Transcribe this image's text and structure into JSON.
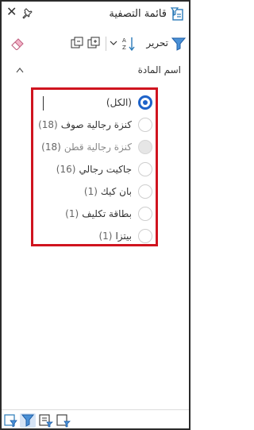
{
  "header": {
    "title": "قائمة التصفية",
    "filter_icon": "filter-list-icon",
    "pin_icon": "pin-icon",
    "close_symbol": "✕"
  },
  "toolbar": {
    "edit_label": "تحرير",
    "icons": [
      "filter-icon",
      "sort-az-icon",
      "chevron-down-icon",
      "expand-all-icon",
      "collapse-all-icon",
      "eraser-icon"
    ]
  },
  "field": {
    "title": "اسم المادة",
    "items": [
      {
        "label": "(الكل)",
        "count": "",
        "selected": true,
        "disabled": false
      },
      {
        "label": "كنزة رجالية صوف",
        "count": "(18)",
        "selected": false,
        "disabled": false
      },
      {
        "label": "كنزة رجالية قطن",
        "count": "(18)",
        "selected": false,
        "disabled": true
      },
      {
        "label": "جاكيت رجالي",
        "count": "(16)",
        "selected": false,
        "disabled": false
      },
      {
        "label": "بان كيك",
        "count": "(1)",
        "selected": false,
        "disabled": false
      },
      {
        "label": "بطاقة تكليف",
        "count": "(1)",
        "selected": false,
        "disabled": false
      },
      {
        "label": "بيتزا",
        "count": "(1)",
        "selected": false,
        "disabled": false
      }
    ]
  },
  "colors": {
    "accent": "#1e63c9",
    "highlight_border": "#d0141f"
  },
  "bottom_tabs": [
    "page-filter-icon",
    "visual-filter-icon",
    "list-filter-icon",
    "report-filter-icon"
  ]
}
